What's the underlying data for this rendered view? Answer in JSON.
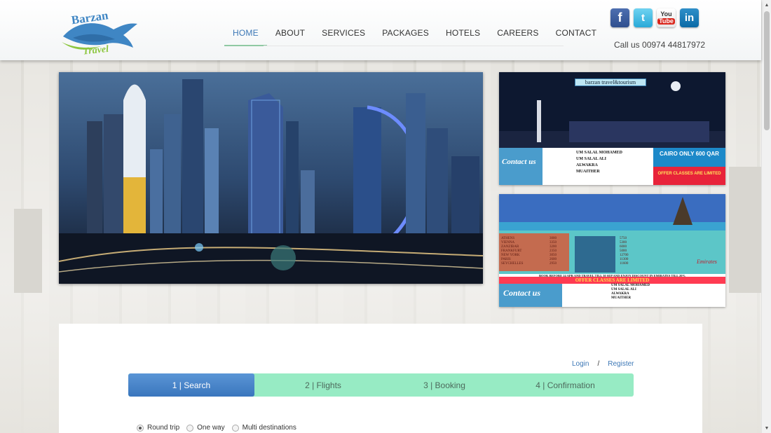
{
  "brand": {
    "name_top": "Barzan",
    "name_bottom": "Travel",
    "colors": {
      "primary": "#3d78b6",
      "accent_green": "#8fc9a3",
      "step_bg": "#97ebc4"
    }
  },
  "nav": {
    "items": [
      {
        "label": "HOME",
        "active": true
      },
      {
        "label": "ABOUT",
        "active": false
      },
      {
        "label": "SERVICES",
        "active": false
      },
      {
        "label": "PACKAGES",
        "active": false
      },
      {
        "label": "HOTELS",
        "active": false
      },
      {
        "label": "CAREERS",
        "active": false
      },
      {
        "label": "CONTACT",
        "active": false
      }
    ]
  },
  "social": {
    "facebook": "f",
    "twitter": "t",
    "youtube_you": "You",
    "youtube_tube": "Tube",
    "linkedin": "in"
  },
  "contact": {
    "call": "Call us 00974 44817972"
  },
  "ads": {
    "ad1": {
      "banner": "barzan travel&tourism",
      "contact": "Contact us",
      "offer_title": "CAIRO ONLY 600 QAR",
      "offer_sub": "OFFER CLASSES ARE LIMITED",
      "branches": [
        "UM SALAL MOHAMED",
        "UM SALAL ALI",
        "ALWAKRA",
        "MUAITHER"
      ]
    },
    "ad2": {
      "airline": "Emirates",
      "offer": "OFFER CLASSES ARE LIMITED",
      "note": "BOOK BEFORE 24 APR AND TRAVEL TILL 30 SEP AND ENJOY DISCOUNT IN EMIRATES TILL 20%",
      "contact": "Contact us",
      "branches": [
        "UM SALAL MOHAMED",
        "UM SALAL ALI",
        "ALWAKRA",
        "MUAITHER"
      ],
      "destinations": [
        "ATHENS",
        "VIENNA",
        "ZANZIBAR",
        "FRANKFURT",
        "NEW YORK",
        "PARIS",
        "SEYCHELLES"
      ],
      "prices_a": [
        "3000",
        "3350",
        "3200",
        "2350",
        "3050",
        "2600",
        "2950"
      ],
      "prices_b": [
        "5750",
        "5300",
        "6000",
        "5000",
        "12700",
        "11300",
        "11600"
      ]
    }
  },
  "auth": {
    "login": "Login",
    "sep": "/",
    "register": "Register"
  },
  "steps": [
    {
      "label": "1 | Search",
      "active": true
    },
    {
      "label": "2 | Flights",
      "active": false
    },
    {
      "label": "3 | Booking",
      "active": false
    },
    {
      "label": "4 | Confirmation",
      "active": false
    }
  ],
  "trip_types": [
    {
      "label": "Round trip",
      "selected": true
    },
    {
      "label": "One way",
      "selected": false
    },
    {
      "label": "Multi destinations",
      "selected": false
    }
  ]
}
